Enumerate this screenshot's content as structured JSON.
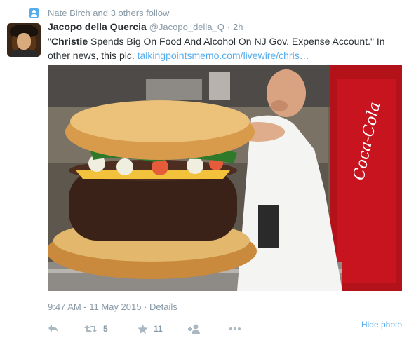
{
  "social_context": {
    "text": "Nate Birch and 3 others follow"
  },
  "tweet": {
    "fullname": "Jacopo della Quercia",
    "username": "@Jacopo_della_Q",
    "separator": "·",
    "time": "2h",
    "text_open_quote": "\"",
    "text_bold": "Christie",
    "text_rest": " Spends Big On Food And Alcohol On NJ Gov. Expense Account.\" In other news, this pic. ",
    "link": "talkingpointsmemo.com/livewire/chris…",
    "timestamp": "9:47 AM - 11 May 2015",
    "meta_dot": "·",
    "details": "Details"
  },
  "photo": {
    "sign_text": "Coca-Cola"
  },
  "actions": {
    "retweet_count": "5",
    "favorite_count": "11",
    "hide_photo": "Hide photo"
  },
  "icons": {
    "context": "person-follow-icon",
    "reply": "reply-icon",
    "retweet": "retweet-icon",
    "favorite": "star-icon",
    "follow": "add-user-icon",
    "more": "more-icon"
  },
  "colors": {
    "link": "#55acee",
    "muted": "#8899a6",
    "text": "#292f33",
    "icon": "#aab8c2"
  }
}
